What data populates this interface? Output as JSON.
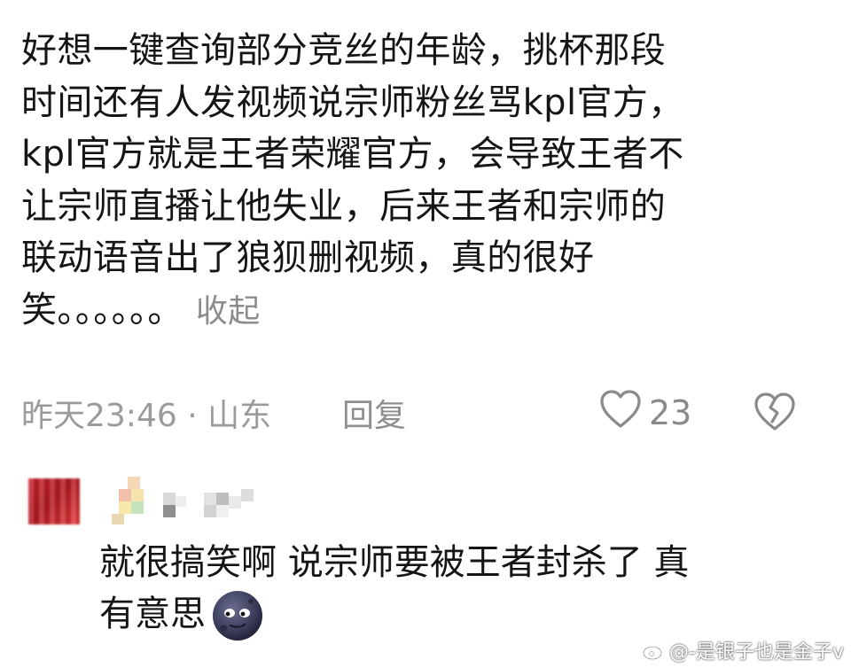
{
  "comment": {
    "lines": [
      "好想一键查询部分竞丝的年龄，挑杯那段",
      "时间还有人发视频说宗师粉丝骂kpl官方，",
      "kpl官方就是王者荣耀官方，会导致王者不",
      "让宗师直播让他失业，后来王者和宗师的",
      "联动语音出了狼狈删视频，真的很好",
      "笑。。。。。。"
    ],
    "collapse_label": "收起",
    "timestamp": "昨天23:46 · 山东",
    "reply_label": "回复",
    "like_count": "23"
  },
  "reply": {
    "lines": [
      "就很搞笑啊 说宗师要被王者封杀了 真",
      "有意思"
    ]
  },
  "watermark": {
    "text": "@-是银子也是金子v"
  },
  "icons": {
    "like": "heart-outline-icon",
    "dislike": "broken-heart-icon",
    "emoji": "new-moon-face-emoji"
  },
  "colors": {
    "text": "#151515",
    "meta": "#9b9b9b",
    "avatar": "#c8232b"
  }
}
